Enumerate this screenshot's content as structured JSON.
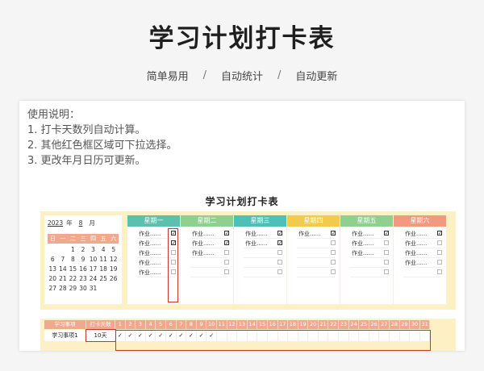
{
  "hero": {
    "title": "学习计划打卡表"
  },
  "subnav": [
    "简单易用",
    "/",
    "自动统计",
    "/",
    "自动更新"
  ],
  "instructions": {
    "heading": "使用说明：",
    "lines": [
      "1. 打卡天数列自动计算。",
      "2. 其他红色框区域可下拉选择。",
      "3. 更改年月日历可更新。"
    ]
  },
  "sheet": {
    "title": "学习计划打卡表"
  },
  "calendar": {
    "year": "2023",
    "year_unit": "年",
    "month": "8",
    "month_unit": "月",
    "weekdays": [
      "日",
      "一",
      "二",
      "三",
      "四",
      "五",
      "六"
    ],
    "days": [
      "",
      "",
      "1",
      "2",
      "3",
      "4",
      "5",
      "6",
      "7",
      "8",
      "9",
      "10",
      "11",
      "12",
      "13",
      "14",
      "15",
      "16",
      "17",
      "18",
      "19",
      "20",
      "21",
      "22",
      "23",
      "24",
      "25",
      "26",
      "27",
      "28",
      "29",
      "30",
      "31"
    ]
  },
  "week": [
    {
      "label": "星期一",
      "color": "#5bc0b0",
      "tasks": [
        "作业......",
        "作业......",
        "作业......",
        "作业......",
        "作业......"
      ],
      "checks": [
        true,
        true,
        false,
        false,
        false
      ]
    },
    {
      "label": "星期二",
      "color": "#8fcf8f",
      "tasks": [
        "作业......",
        "作业......",
        "作业......"
      ],
      "checks": [
        true,
        true,
        false
      ]
    },
    {
      "label": "星期三",
      "color": "#4fc0b8",
      "tasks": [
        "作业......",
        "作业......"
      ],
      "checks": [
        true,
        true
      ]
    },
    {
      "label": "星期四",
      "color": "#f2cb4e",
      "tasks": [
        "作业......"
      ],
      "checks": [
        true
      ]
    },
    {
      "label": "星期五",
      "color": "#8fcf8f",
      "tasks": [
        "作业......",
        "作业......",
        "作业......"
      ],
      "checks": [
        true,
        false,
        false
      ]
    },
    {
      "label": "星期六",
      "color": "#f29a80",
      "tasks": [
        "作业......",
        "作业......",
        "作业......",
        "作业......"
      ],
      "checks": [
        true,
        false,
        false,
        false
      ]
    }
  ],
  "tracker": {
    "headers": [
      "学习事项",
      "打卡天数"
    ],
    "day_numbers": [
      "1",
      "2",
      "3",
      "4",
      "5",
      "6",
      "7",
      "8",
      "9",
      "10",
      "11",
      "12",
      "13",
      "14",
      "15",
      "16",
      "17",
      "18",
      "19",
      "20",
      "21",
      "22",
      "23",
      "24",
      "25",
      "26",
      "27",
      "28",
      "29",
      "30",
      "31"
    ],
    "rows": [
      {
        "item": "学习事项1",
        "count": "10天",
        "marks": 10
      }
    ],
    "check_glyph": "✓"
  }
}
